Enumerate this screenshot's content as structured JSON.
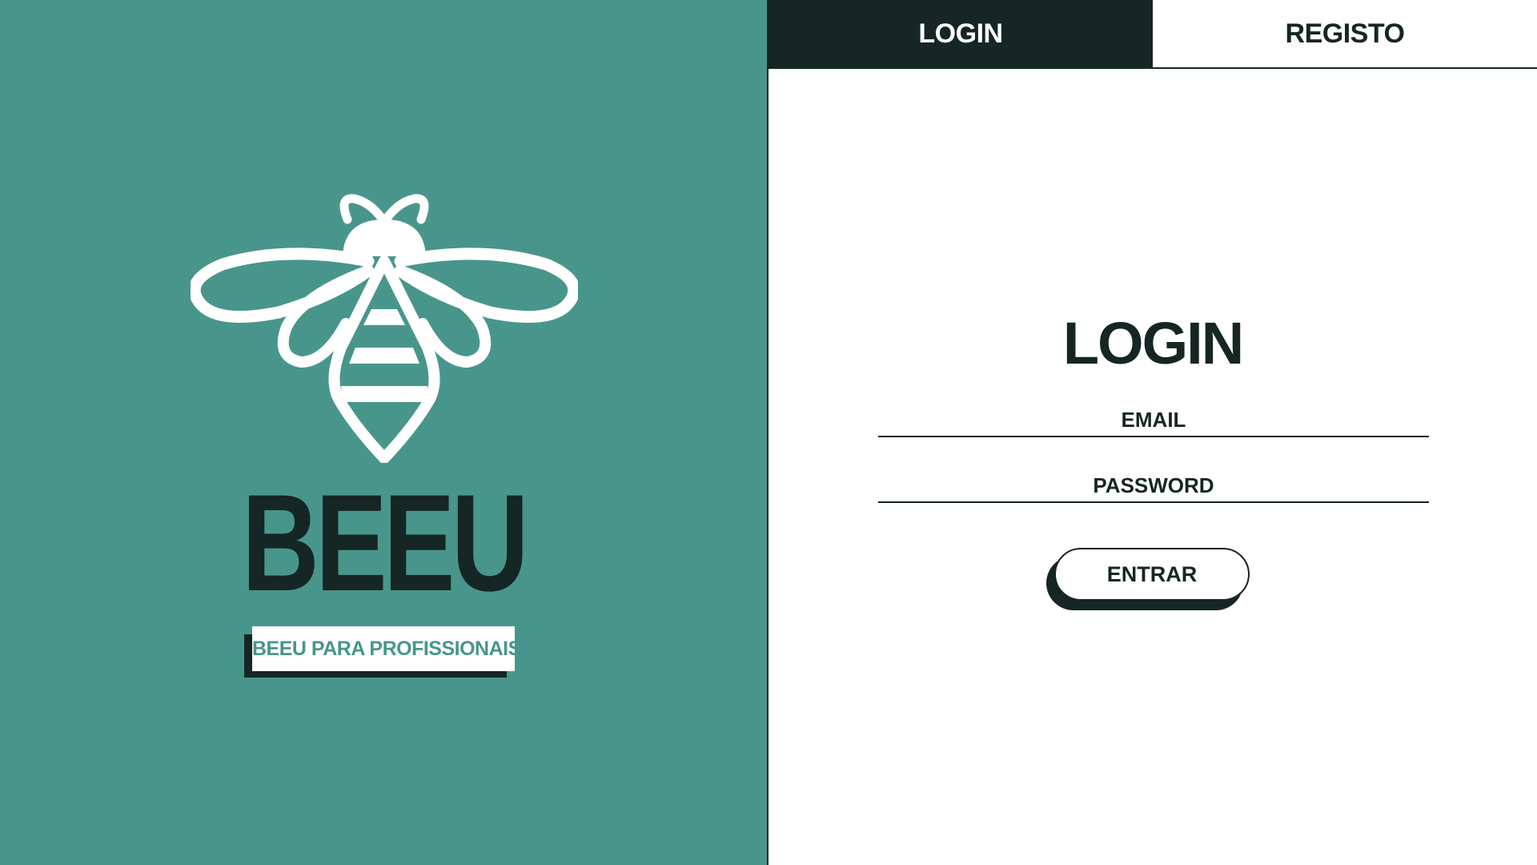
{
  "colors": {
    "brand": "#48968b",
    "dark": "#152624",
    "light": "#ffffff"
  },
  "brand": {
    "logo_icon": "bee-icon",
    "name": "BEEU",
    "pro_link_label": "BEEU PARA PROFISSIONAIS?"
  },
  "tabs": [
    {
      "label": "LOGIN",
      "active": true
    },
    {
      "label": "REGISTO",
      "active": false
    }
  ],
  "form": {
    "title": "LOGIN",
    "email": {
      "placeholder": "EMAIL",
      "value": ""
    },
    "password": {
      "placeholder": "PASSWORD",
      "value": ""
    },
    "submit_label": "ENTRAR"
  }
}
